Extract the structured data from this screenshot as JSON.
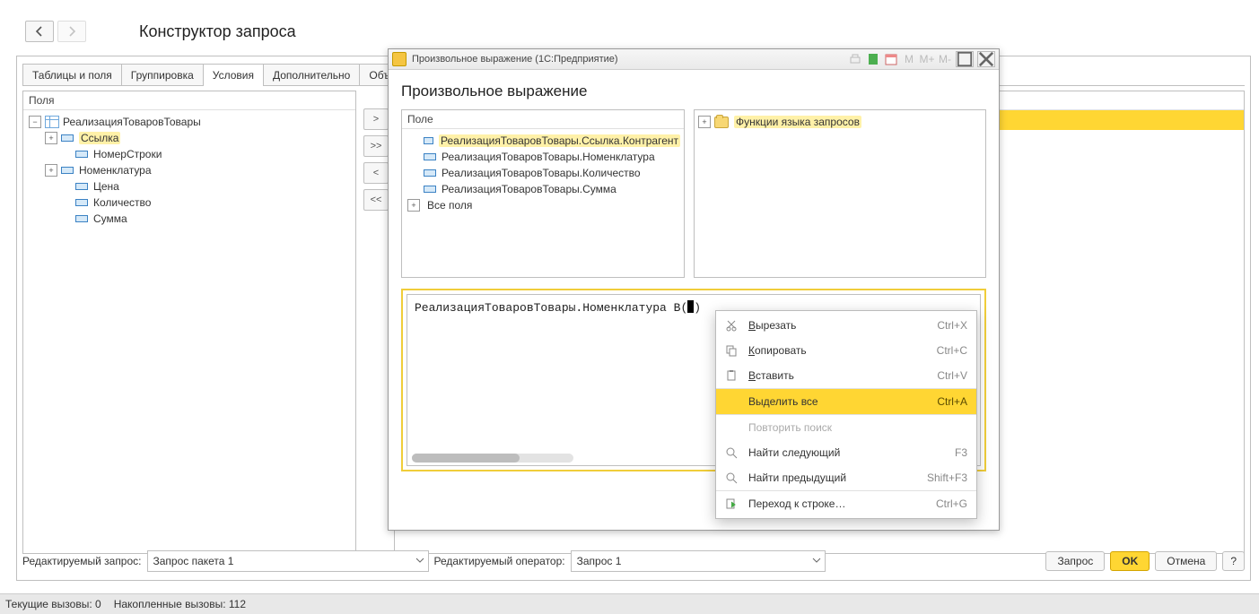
{
  "title": "Конструктор запроса",
  "tabs": [
    "Таблицы и поля",
    "Группировка",
    "Условия",
    "Дополнительно",
    "Объединени"
  ],
  "active_tab_index": 2,
  "fields_header": "Поля",
  "fields_tree": {
    "root": "РеализацияТоваровТовары",
    "children": [
      {
        "label": "Ссылка",
        "highlight": true,
        "expandable": true
      },
      {
        "label": "НомерСтроки"
      },
      {
        "label": "Номенклатура",
        "expandable": true
      },
      {
        "label": "Цена"
      },
      {
        "label": "Количество"
      },
      {
        "label": "Сумма"
      }
    ]
  },
  "arrow_buttons": [
    ">",
    ">>",
    "<",
    "<<"
  ],
  "footer": {
    "label_request": "Редактируемый запрос:",
    "combo_request": "Запрос пакета 1",
    "label_operator": "Редактируемый оператор:",
    "combo_operator": "Запрос 1",
    "btn_query": "Запрос",
    "btn_ok": "OK",
    "btn_cancel": "Отмена",
    "btn_help": "?"
  },
  "status": {
    "current": "Текущие вызовы: 0",
    "accum": "Накопленные вызовы: 112"
  },
  "dialog": {
    "title_text": "Произвольное выражение  (1С:Предприятие)",
    "heading": "Произвольное выражение",
    "subpanel_left_header": "Поле",
    "left_rows": [
      {
        "label": "РеализацияТоваровТовары.Ссылка.Контрагент",
        "highlight": true
      },
      {
        "label": "РеализацияТоваровТовары.Номенклатура"
      },
      {
        "label": "РеализацияТоваровТовары.Количество"
      },
      {
        "label": "РеализацияТоваровТовары.Сумма"
      }
    ],
    "left_all_fields": "Все поля",
    "right_root": "Функции языка запросов",
    "expression_prefix": "РеализацияТоваровТовары.Номенклатура В(",
    "expression_suffix": ")",
    "title_icons": {
      "m": "M",
      "mplus": "M+",
      "mminus": "M-"
    }
  },
  "context_menu": {
    "items": [
      {
        "icon": "cut",
        "label_pre": "",
        "label_u": "В",
        "label_post": "ырезать",
        "shortcut": "Ctrl+X"
      },
      {
        "icon": "copy",
        "label_pre": "",
        "label_u": "К",
        "label_post": "опировать",
        "shortcut": "Ctrl+C"
      },
      {
        "icon": "paste",
        "label_pre": "",
        "label_u": "В",
        "label_post": "ставить",
        "shortcut": "Ctrl+V"
      },
      {
        "icon": "",
        "label_pre": "Выделить все",
        "label_u": "",
        "label_post": "",
        "shortcut": "Ctrl+A",
        "hover": true,
        "sep": true
      },
      {
        "icon": "",
        "label_pre": "Повторить поиск",
        "label_u": "",
        "label_post": "",
        "shortcut": "",
        "disabled": true,
        "sep": true
      },
      {
        "icon": "search",
        "label_pre": "Найти следующий",
        "label_u": "",
        "label_post": "",
        "shortcut": "F3"
      },
      {
        "icon": "search",
        "label_pre": "Найти предыдущий",
        "label_u": "",
        "label_post": "",
        "shortcut": "Shift+F3"
      },
      {
        "icon": "goto",
        "label_pre": "Переход к строке…",
        "label_u": "",
        "label_post": "",
        "shortcut": "Ctrl+G",
        "sep": true
      }
    ]
  }
}
